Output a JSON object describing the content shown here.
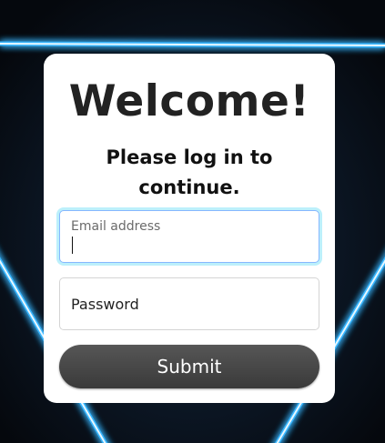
{
  "login": {
    "title": "Welcome!",
    "subtitle": "Please log in to continue.",
    "email_label": "Email address",
    "email_value": "",
    "password_placeholder": "Password",
    "submit_label": "Submit"
  },
  "colors": {
    "accent_focus": "#86b7fe",
    "button": "#4a4a4a",
    "neon": "#38b6ff"
  }
}
